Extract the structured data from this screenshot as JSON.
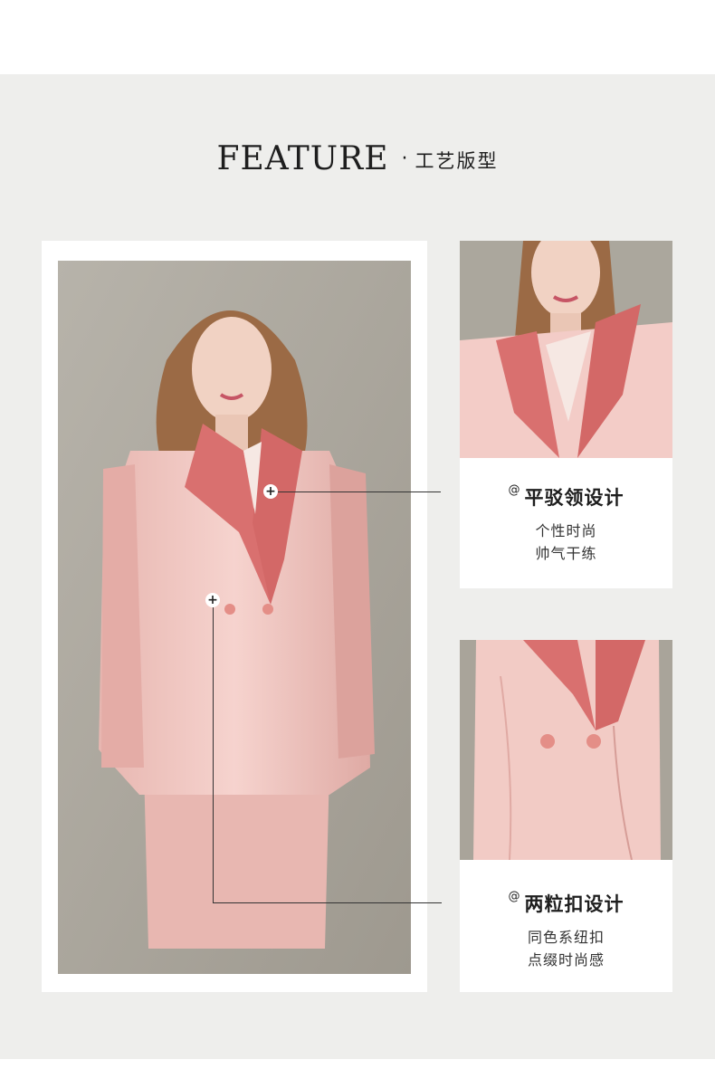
{
  "header": {
    "title": "FEATURE",
    "separator": "·",
    "subtitle": "工艺版型"
  },
  "features": [
    {
      "mark": "@",
      "title": "平驳领设计",
      "lines": [
        "个性时尚",
        "帅气干练"
      ]
    },
    {
      "mark": "@",
      "title": "两粒扣设计",
      "lines": [
        "同色系纽扣",
        "点缀时尚感"
      ]
    }
  ],
  "hotspot_symbol": "+",
  "colors": {
    "background": "#eeeeec",
    "jacket": "#f2c9c4",
    "lapel": "#d9706f",
    "photo_backdrop": "#a7a399",
    "text": "#1e1e1e"
  }
}
